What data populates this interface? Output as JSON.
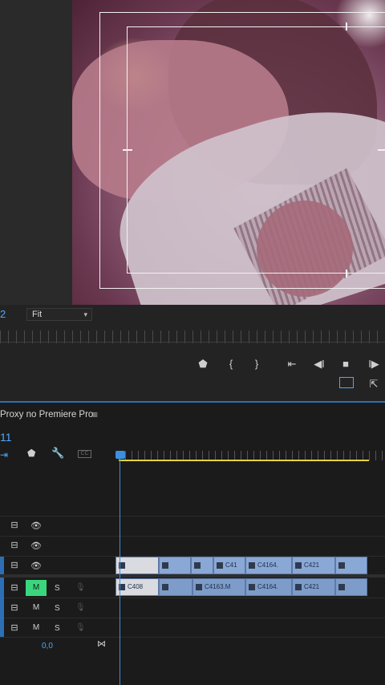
{
  "monitor": {
    "zoom_fraction": "2",
    "fit_label": "Fit",
    "controls": {
      "add_marker": "⬟",
      "mark_in": "{",
      "mark_out": "}",
      "go_to_in": "⇤",
      "step_back": "◀I",
      "stop": "■",
      "play": "I▶",
      "export_frame": "⇱"
    }
  },
  "timeline": {
    "sequence_name": "Proxy no Premiere Pro",
    "menu_icon": "≡",
    "timecode": "11",
    "volume_value": "0,0",
    "tools": {
      "snap": "⇥",
      "marker": "⬟",
      "settings": "🔧",
      "captions": "CC"
    },
    "tracks": {
      "video": [
        {
          "toggle_sync": "⊟",
          "eye": "👁"
        },
        {
          "toggle_sync": "⊟",
          "eye": "👁"
        },
        {
          "toggle_sync": "⊟",
          "eye": "👁"
        }
      ],
      "audio": [
        {
          "toggle_sync": "⊟",
          "mute": "M",
          "solo": "S",
          "mute_active": true
        },
        {
          "toggle_sync": "⊟",
          "mute": "M",
          "solo": "S",
          "mute_active": false
        },
        {
          "toggle_sync": "⊟",
          "mute": "M",
          "solo": "S",
          "mute_active": false
        }
      ]
    },
    "video_clips": [
      "",
      "",
      "",
      "C41",
      "C4164.",
      "C421",
      ""
    ],
    "audio_clips": [
      "C408",
      "",
      "C4163.M",
      "C4164.",
      "C421",
      ""
    ]
  },
  "colors": {
    "accent_blue": "#4aa8ff",
    "playhead": "#3d8fe0",
    "work_area": "#e6d43a",
    "mute_active": "#3ad67d",
    "clip_video": "#8aa8d6"
  }
}
